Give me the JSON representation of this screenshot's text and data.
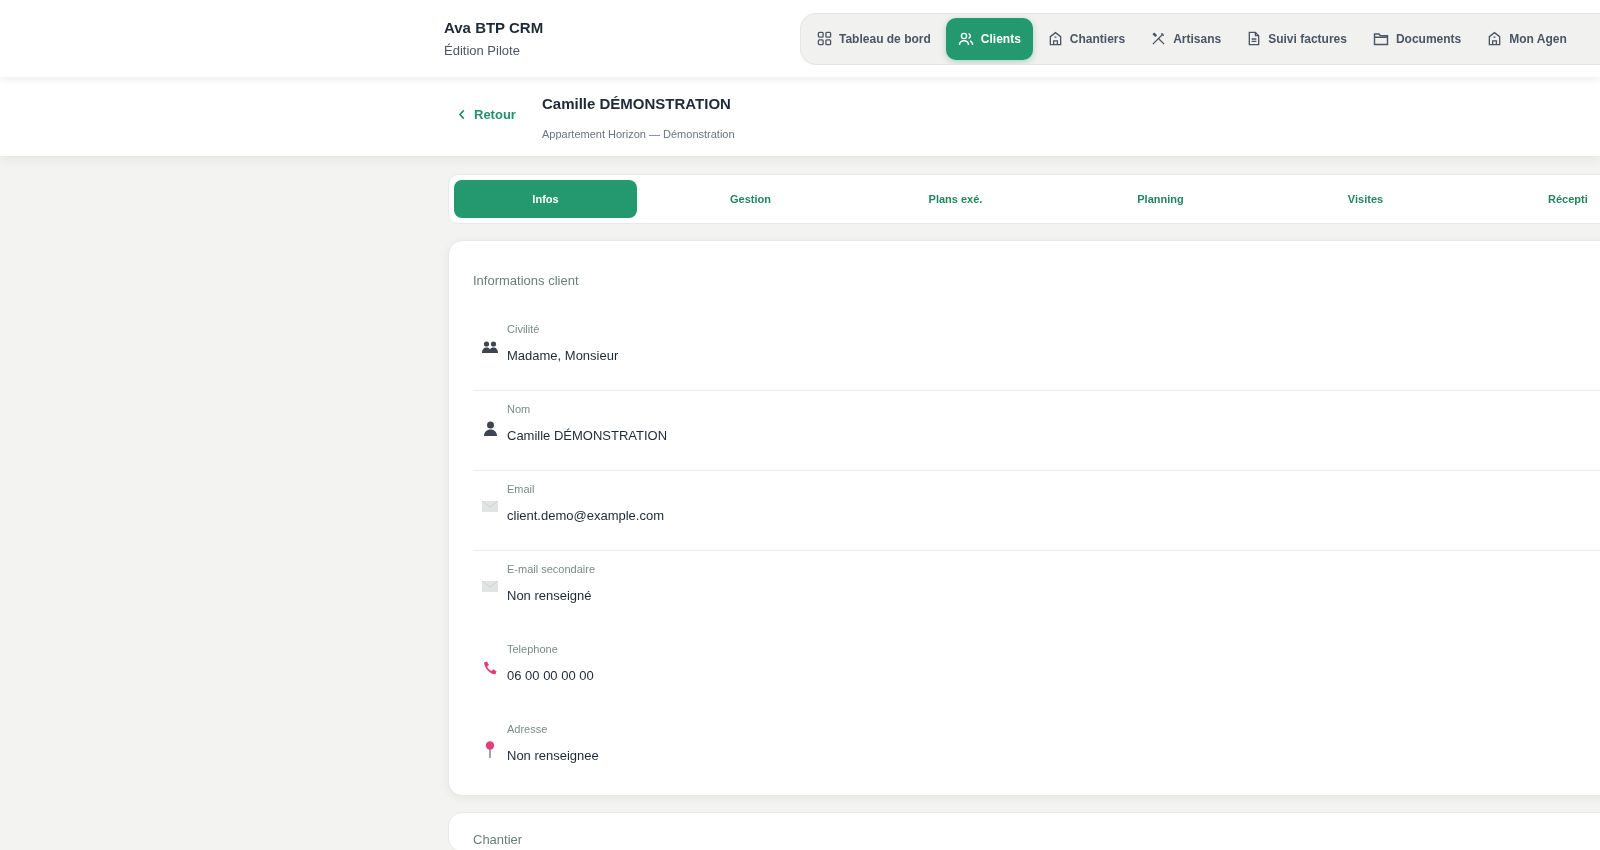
{
  "brand": {
    "title": "Ava BTP CRM",
    "subtitle": "Édition Pilote"
  },
  "nav": [
    {
      "label": "Tableau de bord",
      "selected": false
    },
    {
      "label": "Clients",
      "selected": true
    },
    {
      "label": "Chantiers",
      "selected": false
    },
    {
      "label": "Artisans",
      "selected": false
    },
    {
      "label": "Suivi factures",
      "selected": false
    },
    {
      "label": "Documents",
      "selected": false
    },
    {
      "label": "Mon Agen",
      "selected": false
    }
  ],
  "subheader": {
    "back": "Retour",
    "title": "Camille DÉMONSTRATION",
    "subtitle": "Appartement Horizon — Démonstration"
  },
  "tabs": [
    {
      "label": "Infos",
      "selected": true
    },
    {
      "label": "Gestion",
      "selected": false
    },
    {
      "label": "Plans exé.",
      "selected": false
    },
    {
      "label": "Planning",
      "selected": false
    },
    {
      "label": "Visites",
      "selected": false
    },
    {
      "label": "Récepti",
      "selected": false
    }
  ],
  "client_card": {
    "title": "Informations client",
    "fields": [
      {
        "label": "Civilité",
        "value": "Madame, Monsieur"
      },
      {
        "label": "Nom",
        "value": "Camille DÉMONSTRATION"
      },
      {
        "label": "Email",
        "value": "client.demo@example.com"
      },
      {
        "label": "E-mail secondaire",
        "value": "Non renseigné"
      },
      {
        "label": "Telephone",
        "value": "06 00 00 00 00"
      },
      {
        "label": "Adresse",
        "value": "Non renseignee"
      }
    ]
  },
  "next_card": {
    "title": "Chantier"
  }
}
